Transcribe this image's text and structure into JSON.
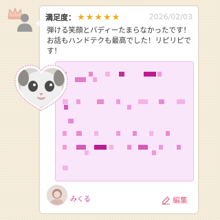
{
  "review": {
    "satisfaction_label": "満足度：",
    "stars": "★★★★★",
    "rating": 5,
    "date": "2026/02/03",
    "text": "弾ける笑顔とバディーたまらなかったです！お話もハンドテクも最高でした！リピリピです！"
  },
  "user": {
    "name": "みくる"
  },
  "actions": {
    "edit_label": "編集"
  },
  "colors": {
    "accent": "#c9469b",
    "star": "#f0ac1a",
    "message_bg": "#fae6fa",
    "message_border": "#f1b8ee",
    "edit": "#d95c7e"
  }
}
